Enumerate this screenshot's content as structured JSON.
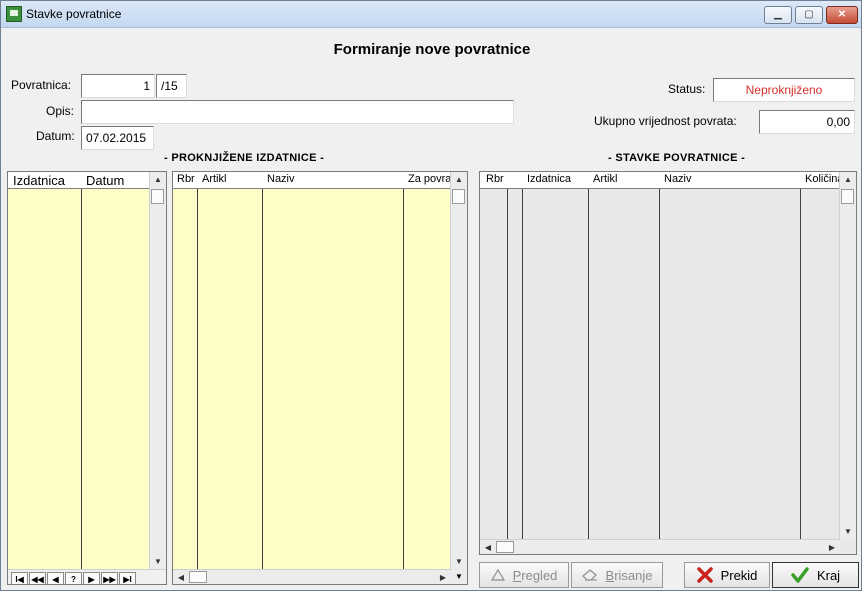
{
  "window": {
    "title": "Stavke povratnice",
    "minimize_glyph": "▁",
    "maximize_glyph": "▢",
    "close_glyph": "✕"
  },
  "heading": "Formiranje nove povratnice",
  "form": {
    "povratnica_label": "Povratnica:",
    "povratnica_number": "1",
    "povratnica_suffix": "/15",
    "opis_label": "Opis:",
    "opis_value": "",
    "datum_label": "Datum:",
    "datum_value": "07.02.2015",
    "status_label": "Status:",
    "status_value": "Neproknjiženo",
    "status_color": "#d4302a",
    "ukupno_label": "Ukupno vrijednost povrata:",
    "ukupno_value": "0,00"
  },
  "left_section": {
    "title": "- PROKNJIŽENE IZDATNICE -",
    "izdatnice_columns": [
      "Izdatnica",
      "Datum"
    ],
    "stavke_columns": [
      "Rbr",
      "Artikl",
      "Naziv",
      "Za povra"
    ]
  },
  "right_section": {
    "title": "- STAVKE POVRATNICE -",
    "columns": [
      "Rbr",
      "",
      "Izdatnica",
      "Artikl",
      "Naziv",
      "Količina"
    ]
  },
  "navigator": {
    "buttons": [
      {
        "glyph": "I◀",
        "name": "first-record-button"
      },
      {
        "glyph": "◀◀",
        "name": "prev-page-button"
      },
      {
        "glyph": "◀",
        "name": "prev-record-button"
      },
      {
        "glyph": "?",
        "name": "search-record-button"
      },
      {
        "glyph": "▶",
        "name": "next-record-button"
      },
      {
        "glyph": "▶▶",
        "name": "next-page-button"
      },
      {
        "glyph": "▶I",
        "name": "last-record-button"
      }
    ]
  },
  "buttons": {
    "pregled_first": "P",
    "pregled_rest": "regled",
    "brisanje_first": "B",
    "brisanje_rest": "risanje",
    "prekid": "Prekid",
    "kraj": "Kraj"
  },
  "colors": {
    "grid_yellow": "#fdfdc8",
    "grid_gray": "#e8e8e8",
    "cancel_red": "#c8221a",
    "ok_green": "#3aa02a"
  },
  "icons": {
    "pregled": "triangle-up-icon",
    "brisanje": "eraser-icon",
    "prekid": "x-cancel-icon",
    "kraj": "checkmark-icon"
  }
}
